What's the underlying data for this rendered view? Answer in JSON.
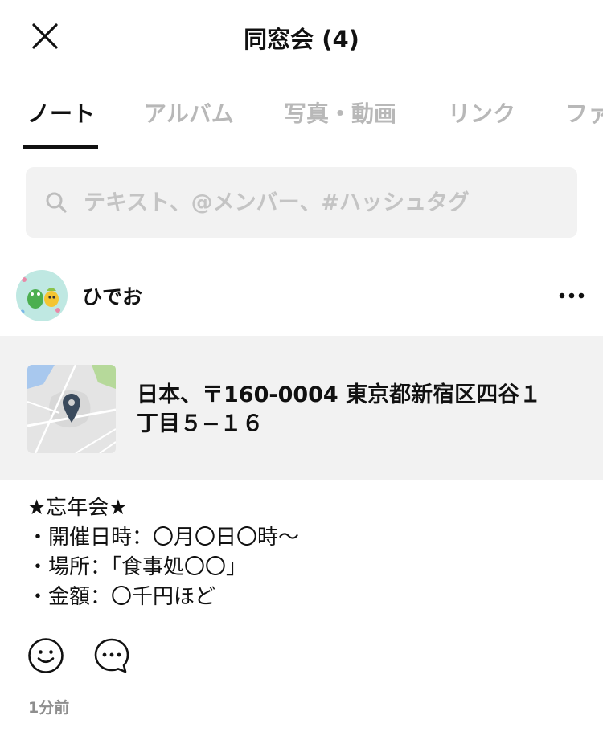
{
  "header": {
    "title": "同窓会 (4)"
  },
  "tabs": [
    {
      "label": "ノート",
      "active": true
    },
    {
      "label": "アルバム",
      "active": false
    },
    {
      "label": "写真・動画",
      "active": false
    },
    {
      "label": "リンク",
      "active": false
    },
    {
      "label": "ファ",
      "active": false
    }
  ],
  "search": {
    "placeholder": "テキスト、@メンバー、#ハッシュタグ",
    "value": ""
  },
  "post": {
    "author": "ひでお",
    "location": {
      "address": "日本、〒160-0004 東京都新宿区四谷１丁目５−１６"
    },
    "body_lines": [
      "★忘年会★",
      "・開催日時：〇月〇日〇時〜",
      "・場所：「食事処〇〇」",
      "・金額：〇千円ほど"
    ],
    "timestamp": "1分前"
  },
  "icons": {
    "close": "close-icon",
    "search": "search-icon",
    "more": "more-icon",
    "map_pin": "map-pin-icon",
    "reaction": "smiley-icon",
    "comment": "comment-icon"
  },
  "colors": {
    "text": "#111111",
    "muted_tab": "#b8b8b8",
    "search_bg": "#f2f2f2",
    "card_bg": "#f2f2f2",
    "pin": "#3a4a5c",
    "timestamp": "#8e8e8e"
  }
}
